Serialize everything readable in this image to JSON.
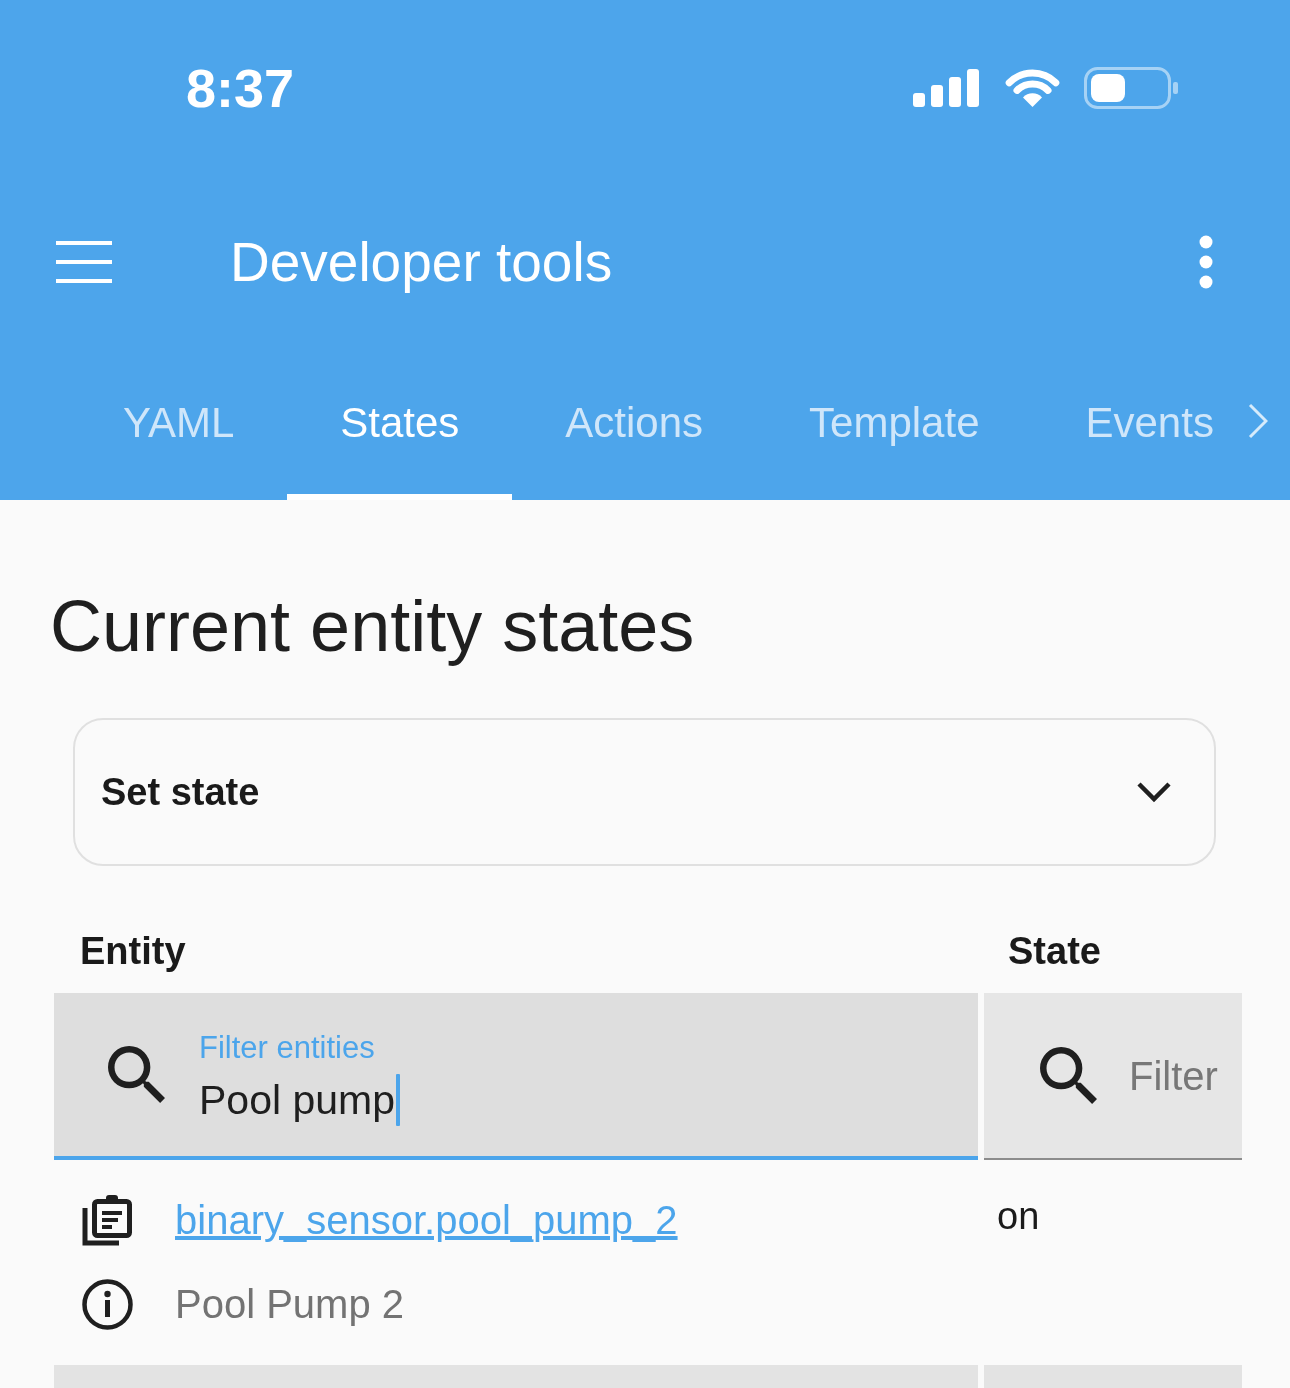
{
  "status_bar": {
    "time": "8:37"
  },
  "toolbar": {
    "title": "Developer tools"
  },
  "tabs": [
    {
      "label": "YAML",
      "selected": false
    },
    {
      "label": "States",
      "selected": true
    },
    {
      "label": "Actions",
      "selected": false
    },
    {
      "label": "Template",
      "selected": false
    },
    {
      "label": "Events",
      "selected": false
    }
  ],
  "heading": "Current entity states",
  "set_state": {
    "label": "Set state",
    "expanded": false
  },
  "table": {
    "columns": [
      {
        "label": "Entity",
        "filter": {
          "label": "Filter entities",
          "value": "Pool pump",
          "focused": true
        }
      },
      {
        "label": "State",
        "filter": {
          "placeholder": "Filter",
          "focused": false
        }
      }
    ],
    "rows": [
      {
        "entity_id": "binary_sensor.pool_pump_2",
        "name": "Pool Pump 2",
        "state": "on"
      }
    ]
  }
}
